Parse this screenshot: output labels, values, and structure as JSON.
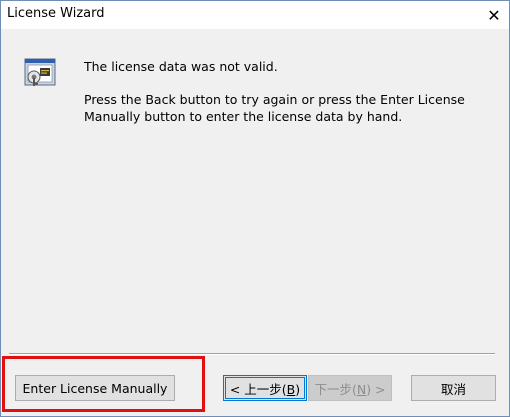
{
  "window": {
    "title": "License Wizard",
    "close_glyph": "✕"
  },
  "message": {
    "line1": "The license data was not valid.",
    "line2": "Press the Back button to try again or press the Enter License Manually button to enter the license data by hand."
  },
  "buttons": {
    "manual": "Enter License Manually",
    "back_prefix": "< 上一步(",
    "back_key": "B",
    "back_suffix": ")",
    "next_prefix": "下一步(",
    "next_key": "N",
    "next_suffix": ") >",
    "cancel": "取消"
  },
  "icons": {
    "wizard": "license-key-icon",
    "close": "close-icon"
  },
  "colors": {
    "highlight": "#e01010",
    "focus": "#0078d7"
  }
}
